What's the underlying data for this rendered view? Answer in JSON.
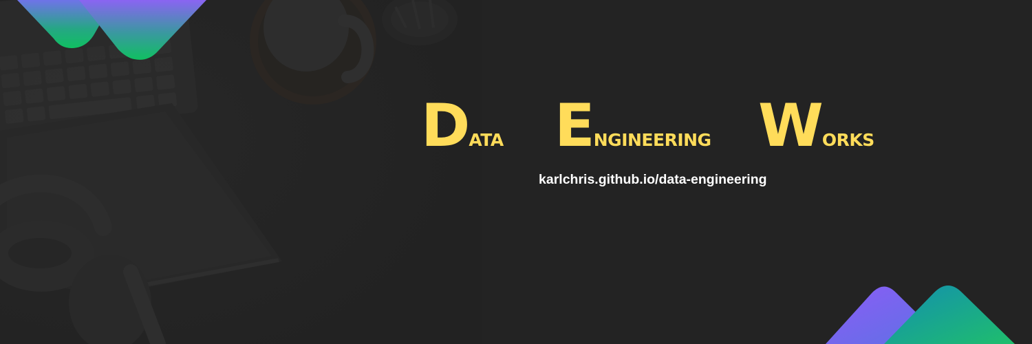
{
  "banner": {
    "title": {
      "words": [
        {
          "initial": "D",
          "rest": "ata"
        },
        {
          "initial": "E",
          "rest": "ngineering"
        },
        {
          "initial": "W",
          "rest": "orks"
        }
      ]
    },
    "url": "karlchris.github.io/data-engineering"
  },
  "colors": {
    "background": "#232323",
    "title": "#FFDC5A",
    "url": "#FFFFFF",
    "gradient_green": "#1DB96A",
    "gradient_teal": "#1496A5",
    "gradient_purple": "#8A5CF6",
    "gradient_blue": "#5A6EE6"
  },
  "icons": [
    "top-left-gradient-shapes",
    "bottom-right-gradient-mountains"
  ]
}
